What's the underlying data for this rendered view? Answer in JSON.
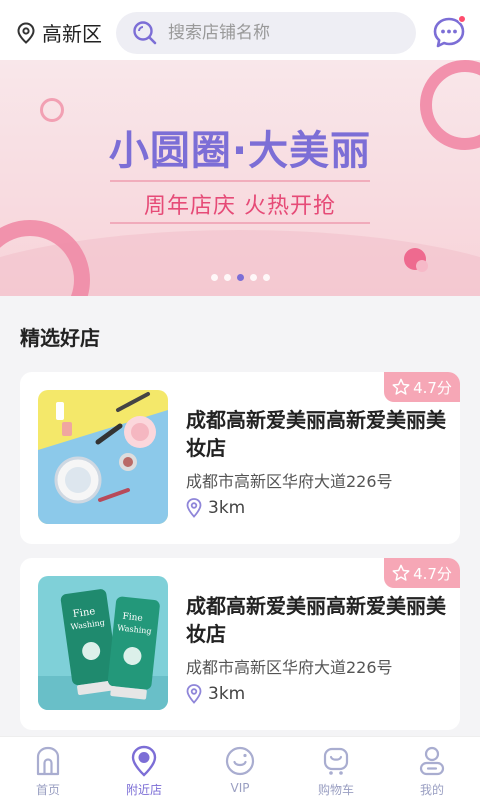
{
  "header": {
    "location": "高新区",
    "search_placeholder": "搜索店铺名称"
  },
  "banner": {
    "title": "小圆圈·大美丽",
    "subtitle": "周年店庆 火热开抢",
    "slide_count": 5,
    "active_slide": 3
  },
  "section": {
    "title": "精选好店"
  },
  "shops": [
    {
      "name": "成都高新爱美丽高新爱美丽美妆店",
      "address": "成都市高新区华府大道226号",
      "distance": "3km",
      "rating": "4.7分",
      "image": "cosmetics-flatlay"
    },
    {
      "name": "成都高新爱美丽高新爱美丽美妆店",
      "address": "成都市高新区华府大道226号",
      "distance": "3km",
      "rating": "4.7分",
      "image": "face-wash-tubes"
    }
  ],
  "tabs": [
    {
      "label": "首页",
      "icon": "home-icon"
    },
    {
      "label": "附近店",
      "icon": "nearby-location-icon"
    },
    {
      "label": "VIP",
      "icon": "vip-icon"
    },
    {
      "label": "购物车",
      "icon": "cart-icon"
    },
    {
      "label": "我的",
      "icon": "profile-icon"
    }
  ],
  "active_tab": 1,
  "colors": {
    "accent": "#7c6ed6",
    "banner_pink": "#f7d3d9",
    "rating_badge": "#f6a7b6"
  }
}
